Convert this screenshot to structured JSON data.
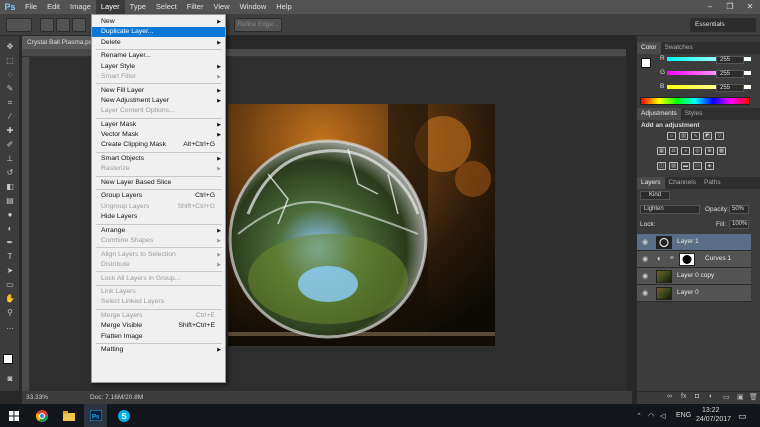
{
  "app": {
    "logo": "Ps",
    "menus": [
      "File",
      "Edit",
      "Image",
      "Layer",
      "Type",
      "Select",
      "Filter",
      "View",
      "Window",
      "Help"
    ],
    "active_menu": "Layer",
    "window_controls": [
      "–",
      "❐",
      "✕"
    ]
  },
  "options": {
    "refine_edge": "Refine Edge...",
    "workspace": "Essentials"
  },
  "document": {
    "tab_title": "Crystal Ball Plasma.psd",
    "zoom": "33.33%",
    "doc_size": "Doc: 7.16M/20.8M"
  },
  "color_panel": {
    "tabs": [
      "Color",
      "Swatches"
    ],
    "sliders": [
      {
        "label": "R",
        "value": "255"
      },
      {
        "label": "G",
        "value": "255"
      },
      {
        "label": "B",
        "value": "255"
      }
    ]
  },
  "adjustments_panel": {
    "tabs": [
      "Adjustments",
      "Styles"
    ],
    "heading": "Add an adjustment"
  },
  "layers_panel": {
    "tabs": [
      "Layers",
      "Channels",
      "Paths"
    ],
    "kind": "Kind",
    "blend_mode": "Lighten",
    "opacity_label": "Opacity:",
    "opacity": "50%",
    "lock_label": "Lock:",
    "fill_label": "Fill:",
    "fill": "100%",
    "layers": [
      {
        "name": "Layer 1",
        "selected": true
      },
      {
        "name": "Curves 1",
        "selected": false
      },
      {
        "name": "Layer 0 copy",
        "selected": false
      },
      {
        "name": "Layer 0",
        "selected": false
      }
    ]
  },
  "layer_menu": [
    {
      "label": "New",
      "shortcut": "",
      "submenu": true,
      "disabled": false
    },
    {
      "label": "Duplicate Layer...",
      "shortcut": "",
      "submenu": false,
      "disabled": false,
      "highlighted": true
    },
    {
      "label": "Delete",
      "shortcut": "",
      "submenu": true,
      "disabled": false
    },
    {
      "sep": true
    },
    {
      "label": "Rename Layer...",
      "shortcut": "",
      "submenu": false,
      "disabled": false
    },
    {
      "label": "Layer Style",
      "shortcut": "",
      "submenu": true,
      "disabled": false
    },
    {
      "label": "Smart Filter",
      "shortcut": "",
      "submenu": true,
      "disabled": true
    },
    {
      "sep": true
    },
    {
      "label": "New Fill Layer",
      "shortcut": "",
      "submenu": true,
      "disabled": false
    },
    {
      "label": "New Adjustment Layer",
      "shortcut": "",
      "submenu": true,
      "disabled": false
    },
    {
      "label": "Layer Content Options...",
      "shortcut": "",
      "submenu": false,
      "disabled": true
    },
    {
      "sep": true
    },
    {
      "label": "Layer Mask",
      "shortcut": "",
      "submenu": true,
      "disabled": false
    },
    {
      "label": "Vector Mask",
      "shortcut": "",
      "submenu": true,
      "disabled": false
    },
    {
      "label": "Create Clipping Mask",
      "shortcut": "Alt+Ctrl+G",
      "submenu": false,
      "disabled": false
    },
    {
      "sep": true
    },
    {
      "label": "Smart Objects",
      "shortcut": "",
      "submenu": true,
      "disabled": false
    },
    {
      "label": "Rasterize",
      "shortcut": "",
      "submenu": true,
      "disabled": true
    },
    {
      "sep": true
    },
    {
      "label": "New Layer Based Slice",
      "shortcut": "",
      "submenu": false,
      "disabled": false
    },
    {
      "sep": true
    },
    {
      "label": "Group Layers",
      "shortcut": "Ctrl+G",
      "submenu": false,
      "disabled": false
    },
    {
      "label": "Ungroup Layers",
      "shortcut": "Shift+Ctrl+G",
      "submenu": false,
      "disabled": true
    },
    {
      "label": "Hide Layers",
      "shortcut": "",
      "submenu": false,
      "disabled": false
    },
    {
      "sep": true
    },
    {
      "label": "Arrange",
      "shortcut": "",
      "submenu": true,
      "disabled": false
    },
    {
      "label": "Combine Shapes",
      "shortcut": "",
      "submenu": true,
      "disabled": true
    },
    {
      "sep": true
    },
    {
      "label": "Align Layers to Selection",
      "shortcut": "",
      "submenu": true,
      "disabled": true
    },
    {
      "label": "Distribute",
      "shortcut": "",
      "submenu": true,
      "disabled": true
    },
    {
      "sep": true
    },
    {
      "label": "Lock All Layers in Group...",
      "shortcut": "",
      "submenu": false,
      "disabled": true
    },
    {
      "sep": true
    },
    {
      "label": "Link Layers",
      "shortcut": "",
      "submenu": false,
      "disabled": true
    },
    {
      "label": "Select Linked Layers",
      "shortcut": "",
      "submenu": false,
      "disabled": true
    },
    {
      "sep": true
    },
    {
      "label": "Merge Layers",
      "shortcut": "Ctrl+E",
      "submenu": false,
      "disabled": true
    },
    {
      "label": "Merge Visible",
      "shortcut": "Shift+Ctrl+E",
      "submenu": false,
      "disabled": false
    },
    {
      "label": "Flatten Image",
      "shortcut": "",
      "submenu": false,
      "disabled": false
    },
    {
      "sep": true
    },
    {
      "label": "Matting",
      "shortcut": "",
      "submenu": true,
      "disabled": false
    }
  ],
  "taskbar": {
    "language": "ENG",
    "time": "13:22",
    "date": "24/07/2017"
  }
}
